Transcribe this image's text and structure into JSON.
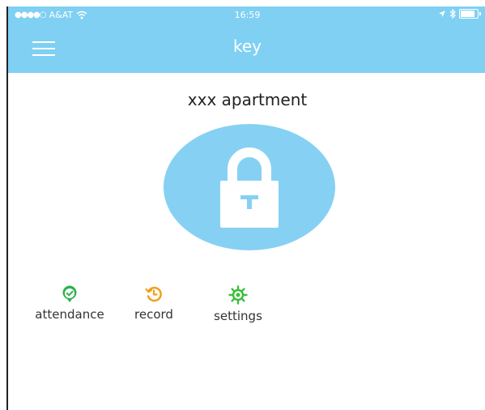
{
  "status_bar": {
    "signal_dots": "●●●●○",
    "carrier": "A&AT",
    "wifi_icon": "wifi-icon",
    "time": "16:59",
    "location_icon": "location-arrow-icon",
    "bluetooth_icon": "bluetooth-icon",
    "battery_icon": "battery-icon"
  },
  "nav": {
    "menu_icon": "hamburger-menu-icon",
    "title": "key"
  },
  "main": {
    "apartment_name": "xxx apartment",
    "lock_icon": "padlock-icon"
  },
  "actions": [
    {
      "label": "attendance",
      "icon": "check-badge-icon",
      "color": "#2bb24c"
    },
    {
      "label": "record",
      "icon": "history-clock-icon",
      "color": "#f0a01e"
    },
    {
      "label": "settings",
      "icon": "gear-icon",
      "color": "#3cbf3c"
    }
  ],
  "colors": {
    "accent": "#7fd0f3",
    "lock_circle": "#86d1f3"
  }
}
